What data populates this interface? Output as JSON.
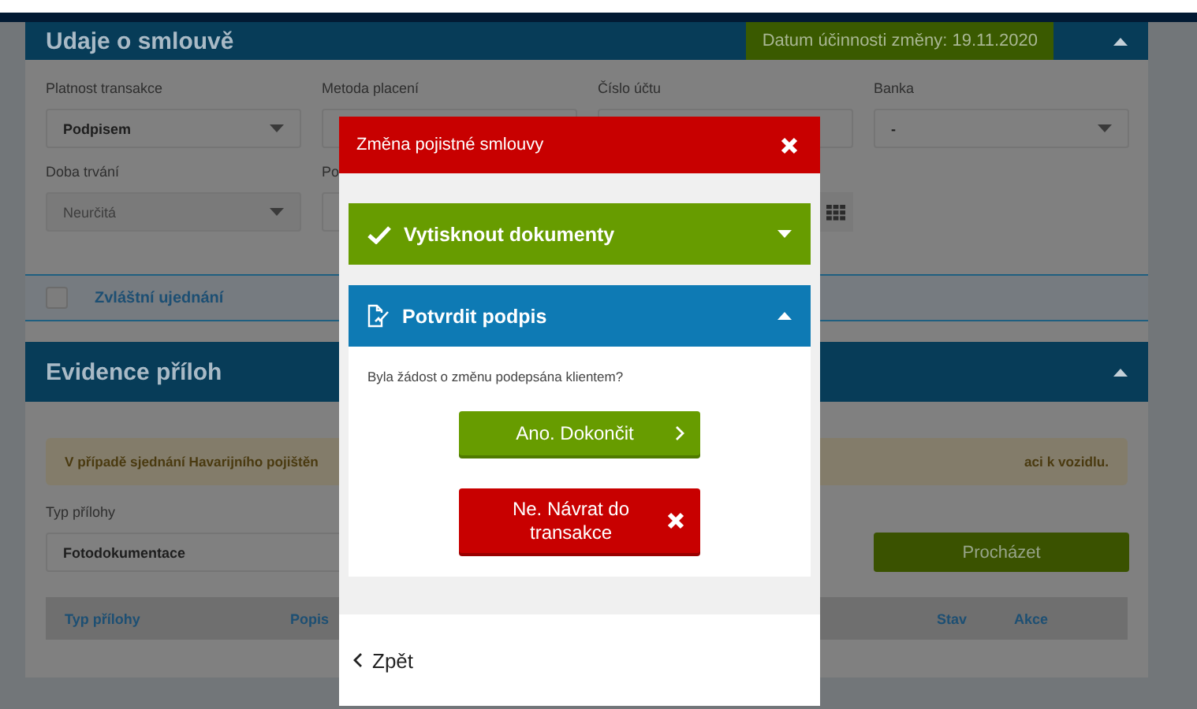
{
  "contract_section": {
    "title": "Udaje o smlouvě",
    "expanded": true,
    "effective_date": "Datum účinnosti změny: 19.11.2020",
    "fields": [
      {
        "kind": "select",
        "label": "Platnost transakce",
        "value": "Podpisem",
        "disabled": false
      },
      {
        "kind": "select",
        "label": "Metoda placení"
      },
      {
        "kind": "input",
        "label": "Číslo účtu"
      },
      {
        "kind": "select",
        "label": "Banka",
        "value": "-",
        "disabled": false
      },
      {
        "kind": "select",
        "label": "Doba trvání",
        "value": "Neurčitá",
        "disabled": true
      },
      {
        "kind": "input",
        "label": "Po"
      },
      {
        "kind": "keypad"
      }
    ]
  },
  "special_terms": {
    "label": "Zvláštní ujednání",
    "checked": false
  },
  "attachments_section": {
    "title": "Evidence příloh",
    "expanded": true,
    "notice_start": "V případě sjednání Havarijního pojištěn",
    "notice_end": "aci k vozidlu.",
    "type_label": "Typ přílohy",
    "type_value": "Fotodokumentace",
    "browse_button": "Procházet",
    "columns": [
      {
        "label": "Typ přílohy"
      },
      {
        "label": "Popis"
      },
      {
        "label": "Stav"
      },
      {
        "label": "Akce"
      }
    ]
  },
  "modal": {
    "title": "Změna pojistné smlouvy",
    "panels": [
      {
        "title": "Vytisknout dokumenty",
        "kind": "print",
        "done": true,
        "expanded": false
      },
      {
        "title": "Potvrdit podpis",
        "kind": "sign",
        "done": false,
        "expanded": true
      }
    ],
    "question": "Byla žádost o změnu podepsána klientem?",
    "confirm_button": "Ano. Dokončit",
    "cancel_button": "Ne. Návrat do transakce",
    "back_button": "Zpět"
  }
}
